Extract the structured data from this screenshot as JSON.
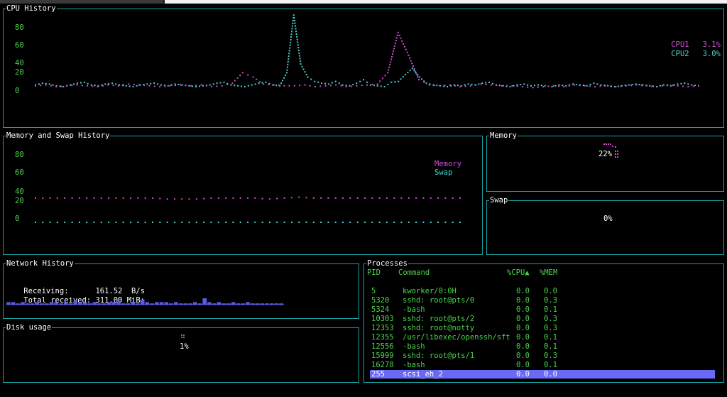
{
  "cpu_history": {
    "title": "CPU History",
    "y_ticks": [
      "80",
      "60",
      "40",
      "20",
      "0"
    ],
    "legend": [
      {
        "name": "CPU1",
        "value": "3.1%",
        "color": "#d24cd2"
      },
      {
        "name": "CPU2",
        "value": "3.0%",
        "color": "#4cd2d2"
      }
    ]
  },
  "mem_history": {
    "title": "Memory and Swap History",
    "y_ticks": [
      "80",
      "60",
      "40",
      "20",
      "0"
    ],
    "legend": [
      {
        "name": "Memory",
        "color": "#d24cd2"
      },
      {
        "name": "Swap",
        "color": "#4cd2d2"
      }
    ]
  },
  "memory_gauge": {
    "title": "Memory",
    "value": "22%"
  },
  "swap_gauge": {
    "title": "Swap",
    "value": "0%"
  },
  "network": {
    "title": "Network History",
    "receiving_label": "Receiving:",
    "receiving_value": "161.52",
    "receiving_unit": "B/s",
    "total_label": "Total received:",
    "total_value": "311.00 MiB:"
  },
  "disk": {
    "title": "Disk usage",
    "value": "1%"
  },
  "processes": {
    "title": "Processes",
    "headers": {
      "pid": "PID",
      "command": "Command",
      "cpu": "%CPU▲",
      "mem": "%MEM"
    },
    "rows": [
      {
        "pid": "5",
        "command": "kworker/0:0H",
        "cpu": "0.0",
        "mem": "0.0"
      },
      {
        "pid": "5320",
        "command": "sshd: root@pts/0",
        "cpu": "0.0",
        "mem": "0.3"
      },
      {
        "pid": "5324",
        "command": "-bash",
        "cpu": "0.0",
        "mem": "0.1"
      },
      {
        "pid": "10303",
        "command": "sshd: root@pts/2",
        "cpu": "0.0",
        "mem": "0.3"
      },
      {
        "pid": "12353",
        "command": "sshd: root@notty",
        "cpu": "0.0",
        "mem": "0.3"
      },
      {
        "pid": "12355",
        "command": "/usr/libexec/openssh/sft",
        "cpu": "0.0",
        "mem": "0.1"
      },
      {
        "pid": "12556",
        "command": "-bash",
        "cpu": "0.0",
        "mem": "0.1"
      },
      {
        "pid": "15999",
        "command": "sshd: root@pts/1",
        "cpu": "0.0",
        "mem": "0.3"
      },
      {
        "pid": "16278",
        "command": "-bash",
        "cpu": "0.0",
        "mem": "0.1"
      },
      {
        "pid": "255",
        "command": "scsi_eh_2",
        "cpu": "0.0",
        "mem": "0.0",
        "selected": true
      }
    ]
  },
  "chart_data": [
    {
      "type": "line",
      "title": "CPU History",
      "ylim": [
        0,
        100
      ],
      "series": [
        {
          "name": "CPU1",
          "values": [
            5,
            6,
            4,
            5,
            6,
            5,
            4,
            6,
            5,
            7,
            6,
            5,
            4,
            5,
            6,
            5,
            6,
            4,
            5,
            8,
            20,
            15,
            7,
            6,
            5,
            5,
            6,
            4,
            5,
            6,
            4,
            5,
            6,
            7,
            20,
            66,
            40,
            12,
            6,
            5,
            6,
            4,
            5,
            7,
            6,
            5,
            5,
            4,
            3,
            4,
            5,
            4,
            6,
            5,
            4,
            5,
            4,
            5,
            6,
            5,
            4,
            6,
            5,
            4,
            5
          ]
        },
        {
          "name": "CPU2",
          "values": [
            6,
            8,
            7,
            5,
            4,
            6,
            8,
            9,
            6,
            5,
            7,
            8,
            6,
            5,
            4,
            6,
            7,
            8,
            6,
            5,
            7,
            6,
            5,
            4,
            5,
            6,
            8,
            9,
            6,
            5,
            4,
            6,
            8,
            9,
            6,
            5,
            20,
            86,
            30,
            15,
            10,
            8,
            7,
            10,
            6,
            5,
            8,
            12,
            6,
            5,
            4,
            9,
            10,
            18,
            25,
            15,
            8,
            6,
            5,
            4,
            6,
            5,
            7,
            6,
            8,
            9,
            6,
            5,
            4,
            6,
            7,
            5,
            6,
            5,
            4,
            6,
            5,
            7,
            6,
            5,
            8,
            6,
            5,
            4,
            5,
            6,
            7,
            6,
            5,
            4,
            6,
            5,
            7,
            8,
            6,
            5
          ]
        }
      ]
    },
    {
      "type": "line",
      "title": "Memory and Swap History",
      "ylim": [
        0,
        100
      ],
      "series": [
        {
          "name": "Memory",
          "values": [
            22,
            22,
            22,
            22,
            22,
            22,
            22,
            22,
            22,
            21,
            21,
            21,
            22,
            22,
            22,
            22,
            21,
            22,
            23,
            22,
            22,
            22,
            22,
            22,
            22,
            22,
            22,
            22,
            22,
            22
          ]
        },
        {
          "name": "Swap",
          "values": [
            0,
            0,
            0,
            0,
            0,
            0,
            0,
            0,
            0,
            0,
            0,
            0,
            0,
            0,
            0,
            0,
            0,
            0,
            0,
            0,
            0,
            0,
            0,
            0,
            0,
            0,
            0,
            0,
            0,
            0
          ]
        }
      ]
    },
    {
      "type": "bar",
      "title": "Network History",
      "values": [
        2,
        2,
        1,
        2,
        1,
        1,
        2,
        1,
        1,
        2,
        2,
        1,
        2,
        1,
        3,
        2,
        2,
        1,
        2,
        1,
        1,
        2,
        2,
        3,
        1,
        1,
        2,
        1,
        4,
        2,
        1,
        2,
        2,
        2,
        1,
        2,
        1,
        1,
        1,
        2,
        1,
        5,
        2,
        1,
        2,
        1,
        1,
        2,
        1,
        1,
        2,
        1,
        1,
        1,
        1,
        1,
        1,
        1
      ]
    }
  ]
}
